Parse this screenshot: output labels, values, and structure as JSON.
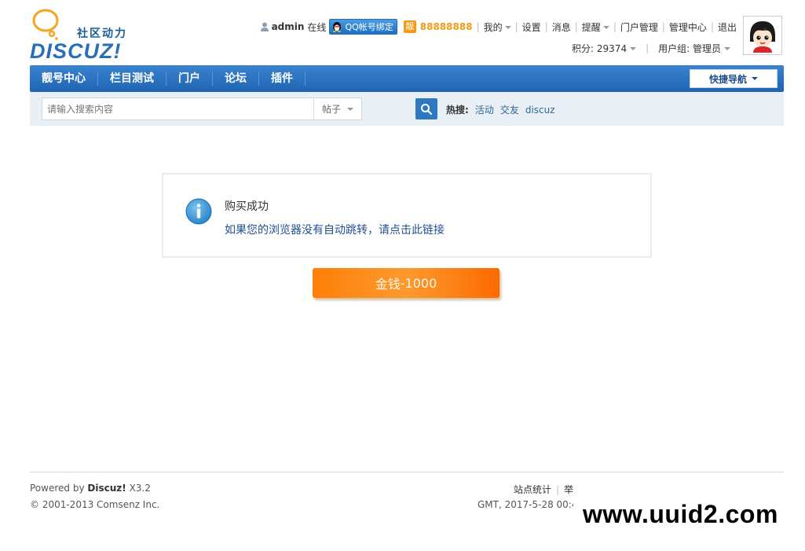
{
  "logo": {
    "tagline": "社区动力",
    "wordmark": "DISCUZ!"
  },
  "userbar": {
    "username": "admin",
    "status": "在线",
    "qq_bind": "QQ帐号绑定",
    "liang_badge": "靓",
    "liang_number": "88888888",
    "links": [
      "我的",
      "设置",
      "消息",
      "提醒",
      "门户管理",
      "管理中心",
      "退出"
    ],
    "credits": "积分: 29374",
    "usergroup": "用户组: 管理员"
  },
  "nav": {
    "items": [
      "靓号中心",
      "栏目测试",
      "门户",
      "论坛",
      "插件"
    ],
    "quick_nav": "快捷导航"
  },
  "search": {
    "placeholder": "请输入搜索内容",
    "type": "帖子",
    "hot_label": "热搜:",
    "hot_links": [
      "活动",
      "交友",
      "discuz"
    ]
  },
  "message": {
    "title": "购买成功",
    "link": "如果您的浏览器没有自动跳转，请点击此链接"
  },
  "reward": {
    "label": "金钱",
    "value": "-1000"
  },
  "footer": {
    "powered_prefix": "Powered by",
    "powered_brand": "Discuz!",
    "powered_version": "X3.2",
    "copyright": "© 2001-2013 Comsenz Inc.",
    "links": [
      "站点统计",
      "举"
    ],
    "time": "GMT, 2017-5-28 00:45"
  },
  "watermark": "www.uuid2.com"
}
